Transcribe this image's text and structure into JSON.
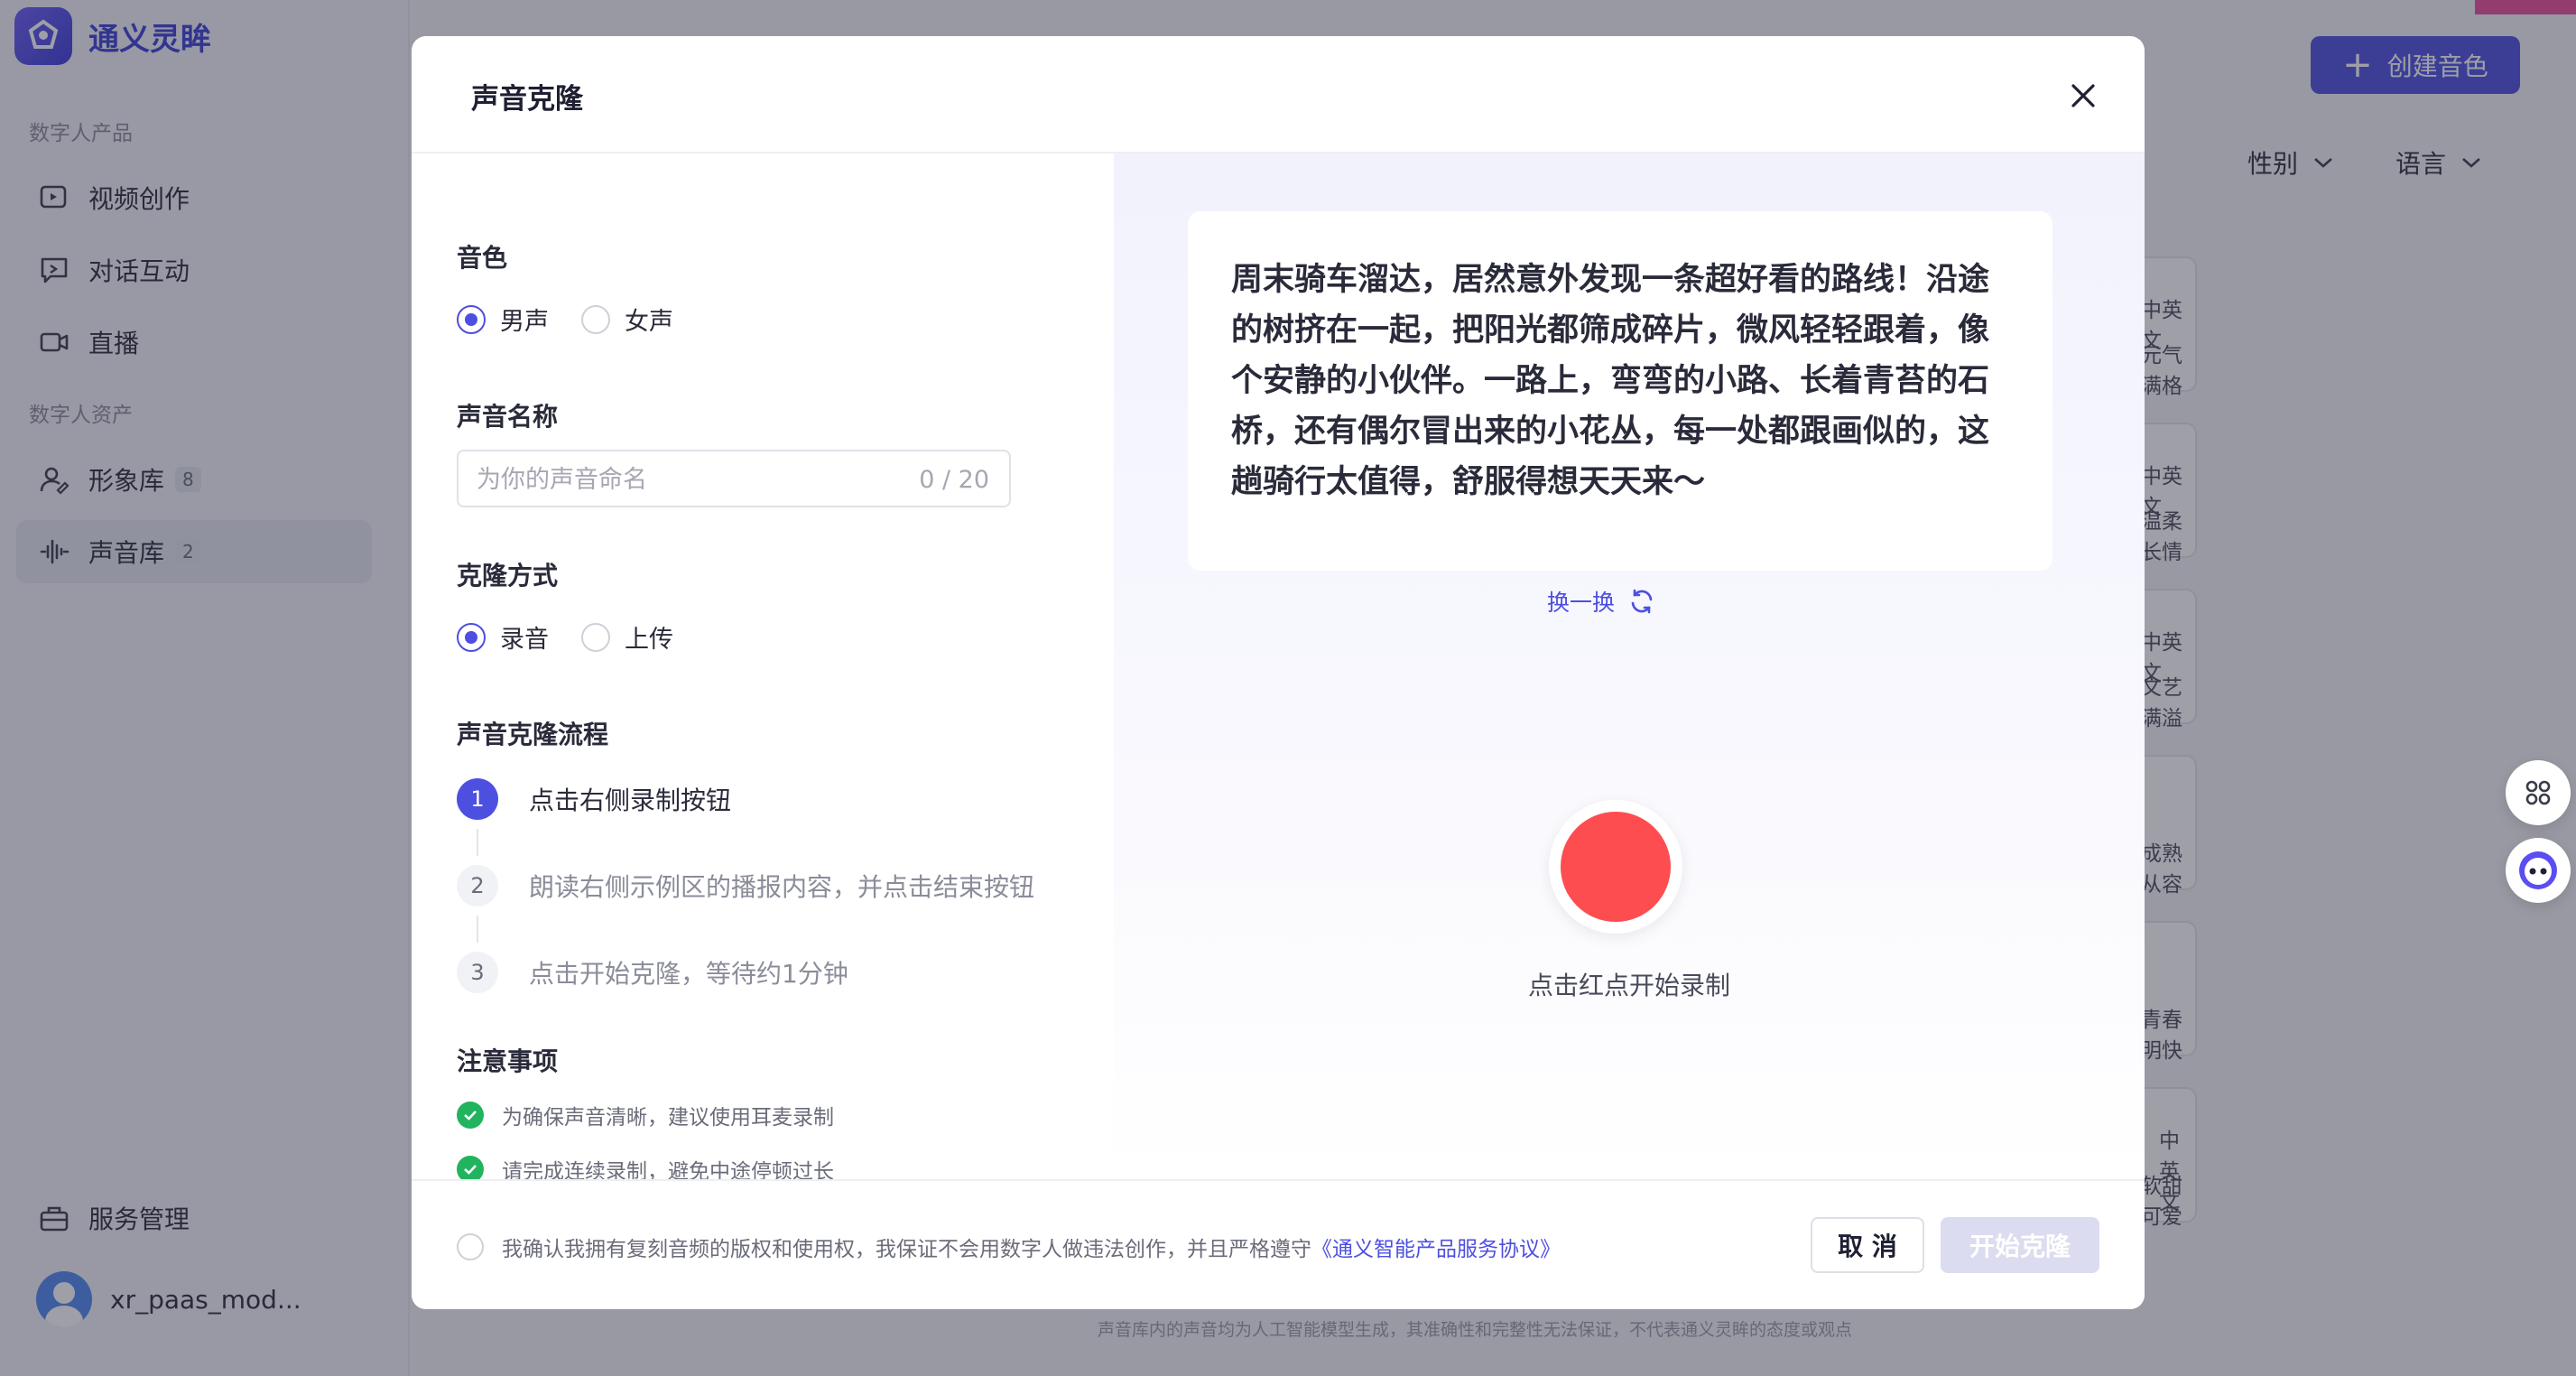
{
  "app": {
    "name": "通义灵眸"
  },
  "sidebar": {
    "section_products": "数字人产品",
    "section_assets": "数字人资产",
    "items": [
      {
        "label": "视频创作",
        "icon": "video-edit-icon"
      },
      {
        "label": "对话互动",
        "icon": "chat-interact-icon"
      },
      {
        "label": "直播",
        "icon": "live-camera-icon"
      },
      {
        "label": "形象库",
        "icon": "avatar-library-icon",
        "badge": "8"
      },
      {
        "label": "声音库",
        "icon": "waveform-icon",
        "badge": "2"
      }
    ],
    "service": {
      "label": "服务管理",
      "icon": "briefcase-icon"
    },
    "user": {
      "name": "xr_paas_mod..."
    }
  },
  "main": {
    "create_button": "创建音色",
    "filters": {
      "gender": "性别",
      "language": "语言"
    },
    "cards": [
      {
        "lang": "中英文",
        "desc": "元气满格"
      },
      {
        "lang": "中英文",
        "desc": "温柔长情"
      },
      {
        "lang": "中英文",
        "desc": "文艺满溢"
      },
      {
        "lang": "",
        "desc": "成熟从容"
      },
      {
        "lang": "",
        "desc": "青春明快"
      },
      {
        "lang": "中英文",
        "desc": "软甜可爱"
      }
    ],
    "footer_note": "声音库内的声音均为人工智能模型生成，其准确性和完整性无法保证，不代表通义灵眸的态度或观点"
  },
  "modal": {
    "title": "声音克隆",
    "timbre": {
      "label": "音色",
      "options": [
        "男声",
        "女声"
      ],
      "selected": "男声"
    },
    "name": {
      "label": "声音名称",
      "placeholder": "为你的声音命名",
      "value": "",
      "counter": "0 / 20"
    },
    "method": {
      "label": "克隆方式",
      "options": [
        "录音",
        "上传"
      ],
      "selected": "录音"
    },
    "process": {
      "label": "声音克隆流程",
      "steps": [
        {
          "num": "1",
          "text": "点击右侧录制按钮"
        },
        {
          "num": "2",
          "text": "朗读右侧示例区的播报内容，并点击结束按钮"
        },
        {
          "num": "3",
          "text": "点击开始克隆，等待约1分钟"
        }
      ]
    },
    "notes": {
      "label": "注意事项",
      "items": [
        "为确保声音清晰，建议使用耳麦录制",
        "请完成连续录制，避免中途停顿过长"
      ]
    },
    "sample_text": "周末骑车溜达，居然意外发现一条超好看的路线！沿途的树挤在一起，把阳光都筛成碎片，微风轻轻跟着，像个安静的小伙伴。一路上，弯弯的小路、长着青苔的石桥，还有偶尔冒出来的小花丛，每一处都跟画似的，这趟骑行太值得，舒服得想天天来～",
    "refresh": "换一换",
    "record_hint": "点击红点开始录制",
    "agreement": {
      "text": "我确认我拥有复刻音频的版权和使用权，我保证不会用数字人做违法创作，并且严格遵守",
      "link": "《通义智能产品服务协议》"
    },
    "cancel": "取 消",
    "start": "开始克隆"
  },
  "colors": {
    "accent": "#4d4fe0",
    "record": "#fe4d50",
    "success": "#22b35e"
  }
}
